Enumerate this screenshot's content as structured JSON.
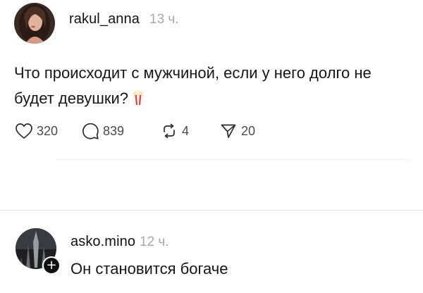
{
  "post": {
    "author": "rakul_anna",
    "time": "13 ч.",
    "text": "Что происходит с мужчиной, если у него долго не будет девушки?",
    "emoji_icon": "popcorn-icon",
    "actions": {
      "likes": "320",
      "comments": "839",
      "reposts": "4",
      "shares": "20"
    }
  },
  "reply": {
    "author": "asko.mino",
    "time": "12 ч.",
    "text": "Он становится богаче",
    "badge_icon": "plus-icon"
  },
  "colors": {
    "text": "#111111",
    "muted": "#a8a8a8",
    "divider": "#e6e6e6"
  }
}
